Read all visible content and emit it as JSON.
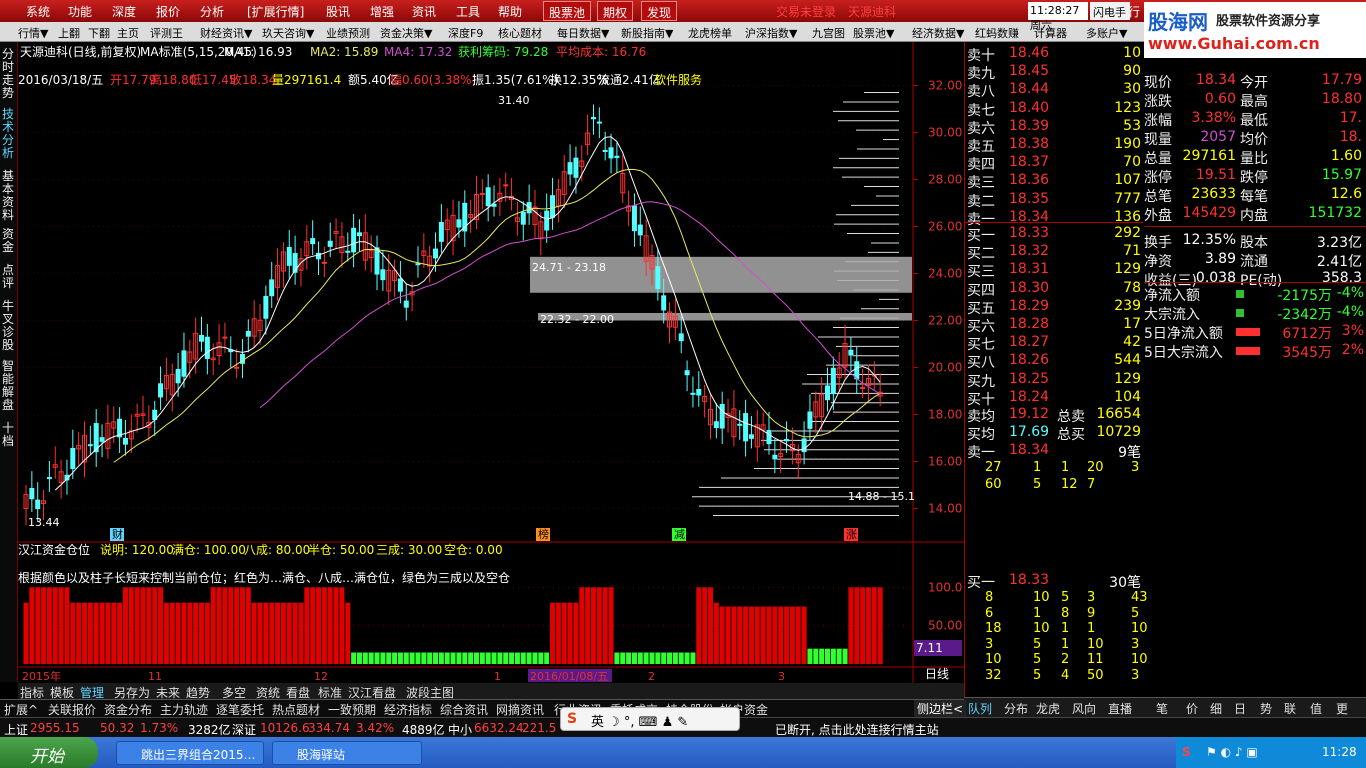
{
  "menubar": {
    "items": [
      "系统",
      "功能",
      "深度",
      "报价",
      "分析",
      "[扩展行情]",
      "股讯",
      "增强",
      "资讯",
      "工具",
      "帮助"
    ],
    "highlights": [
      "股票池",
      "期权",
      "发现"
    ],
    "login_warning": "交易未登录",
    "stock_name_top": "天源迪科",
    "clock": "11:28:27 周六",
    "flash_button": "闪电手",
    "trade_button": "行"
  },
  "brand": {
    "logo": "股海网",
    "slogan": "股票软件资源分享",
    "url": "www.Guhai.com.cn"
  },
  "toolbar": {
    "items": [
      "行情▼",
      "上翻",
      "下翻",
      "主页",
      "评测王",
      "财经资讯▼",
      "玖天咨询▼",
      "业绩预测",
      "资金决策▼",
      "深度F9",
      "核心题材",
      "每日数据▼",
      "新股指南▼",
      "龙虎榜单",
      "沪深指数▼",
      "九宫图",
      "股票池▼",
      "经济数据▼",
      "红蚂数赚",
      "计算器",
      "多账户▼"
    ]
  },
  "left_tabs": [
    {
      "label": "分时走势",
      "active": false
    },
    {
      "label": "技术分析",
      "active": true
    },
    {
      "label": "基本资料",
      "active": false
    },
    {
      "label": "资金",
      "active": false
    },
    {
      "label": "点评",
      "active": false
    },
    {
      "label": "牛叉诊股",
      "active": false
    },
    {
      "label": "智能解盘",
      "active": false
    },
    {
      "label": "十档",
      "active": false
    }
  ],
  "chart_header": {
    "title": "天源迪科(日线,前复权)",
    "ma_label": "MA标准(5,15,20,45)",
    "ma1": "MA1: 16.93",
    "ma2": "MA2: 15.89",
    "ma4": "MA4: 17.32",
    "profit_chips": "获利筹码: 79.28",
    "avg_cost": "平均成本: 16.76"
  },
  "ohlc_line": {
    "date": "2016/03/18/五",
    "open": "开17.79",
    "high": "高18.80",
    "low": "低17.45",
    "close": "收18.34",
    "volume": "量297161.4",
    "amount": "额5.40亿",
    "change": "幅0.60(3.38%)",
    "amplitude": "振1.35(7.61%)",
    "turnover": "换12.35%",
    "float": "流通2.41亿",
    "sector": "软件服务"
  },
  "chart_data": {
    "type": "candlestick",
    "x_range": [
      "2015年",
      "2016/01/08/五"
    ],
    "ylim": [
      13,
      33
    ],
    "y_ticks": [
      "32.00",
      "30.00",
      "28.00",
      "26.00",
      "24.00",
      "22.00",
      "20.00",
      "18.00",
      "16.00",
      "14.00"
    ],
    "price_labels": {
      "high": "31.40",
      "low": "13.44",
      "gap1": "24.71 - 23.18",
      "gap2": "22.32 - 22.00",
      "recent": "14.88 - 15.1"
    },
    "markers": [
      "财",
      "榜",
      "减",
      "涨"
    ],
    "sub_indicator": {
      "title": "汉江资金仓位",
      "description": "说明: 120.00",
      "full": "满仓: 100.00",
      "eighty": "八成: 80.00",
      "half": "半仓: 50.00",
      "thirty": "三成: 30.00",
      "empty": "空仓: 0.00",
      "note": "根据颜色以及柱子长短来控制当前仓位；红色为…满仓、八成…满仓位，绿色为三成以及空仓",
      "y_ticks": [
        "100.0",
        "50.00"
      ],
      "value_box": "7.11"
    },
    "x_axis": [
      "2015年",
      "11",
      "12",
      "1",
      "2016/01/08/五",
      "2",
      "3"
    ],
    "period": "日线"
  },
  "bottom_tabs": [
    "指标",
    "模板",
    "管理",
    "另存为",
    "未来",
    "趋势",
    "多空",
    "资统",
    "看盘",
    "标准",
    "汉江看盘",
    "波段主图"
  ],
  "ext_tabs": [
    "扩展^",
    "关联报价",
    "资金分布",
    "主力轨迹",
    "逐笔委托",
    "热点题材",
    "一致预期",
    "经济指标",
    "综合资讯",
    "网摘资讯",
    "行业资讯",
    "委托成交",
    "持仓股份",
    "帐户资金"
  ],
  "orderbook": {
    "sells": [
      {
        "l": "卖十",
        "p": "18.46",
        "v": "10"
      },
      {
        "l": "卖九",
        "p": "18.45",
        "v": "90"
      },
      {
        "l": "卖八",
        "p": "18.44",
        "v": "30"
      },
      {
        "l": "卖七",
        "p": "18.40",
        "v": "123"
      },
      {
        "l": "卖六",
        "p": "18.39",
        "v": "53"
      },
      {
        "l": "卖五",
        "p": "18.38",
        "v": "190"
      },
      {
        "l": "卖四",
        "p": "18.37",
        "v": "70"
      },
      {
        "l": "卖三",
        "p": "18.36",
        "v": "107"
      },
      {
        "l": "卖二",
        "p": "18.35",
        "v": "777"
      },
      {
        "l": "卖一",
        "p": "18.34",
        "v": "136"
      }
    ],
    "buys": [
      {
        "l": "买一",
        "p": "18.33",
        "v": "292"
      },
      {
        "l": "买二",
        "p": "18.32",
        "v": "71"
      },
      {
        "l": "买三",
        "p": "18.31",
        "v": "129"
      },
      {
        "l": "买四",
        "p": "18.30",
        "v": "78"
      },
      {
        "l": "买五",
        "p": "18.29",
        "v": "239"
      },
      {
        "l": "买六",
        "p": "18.28",
        "v": "17"
      },
      {
        "l": "买七",
        "p": "18.27",
        "v": "42"
      },
      {
        "l": "买八",
        "p": "18.26",
        "v": "544"
      },
      {
        "l": "买九",
        "p": "18.25",
        "v": "129"
      },
      {
        "l": "买十",
        "p": "18.24",
        "v": "104"
      }
    ],
    "avg_sell": "19.12",
    "total_sell": "16654",
    "avg_buy": "17.69",
    "total_buy": "10729",
    "sell1_price": "18.34",
    "sell1_count": "9笔",
    "sell1_queue": [
      "27",
      "1",
      "1",
      "20",
      "3",
      "60",
      "5",
      "12",
      "7"
    ],
    "buy1_price": "18.33",
    "buy1_count": "30笔",
    "buy1_queue": [
      "8",
      "10",
      "5",
      "3",
      "43",
      "6",
      "1",
      "8",
      "9",
      "5",
      "18",
      "10",
      "1",
      "1",
      "10",
      "3",
      "5",
      "1",
      "10",
      "3",
      "10",
      "5",
      "2",
      "11",
      "10",
      "32",
      "5",
      "4",
      "50",
      "3"
    ]
  },
  "quote": {
    "rows": [
      {
        "a": "现价",
        "av": "18.34",
        "b": "今开",
        "bv": "17.79"
      },
      {
        "a": "涨跌",
        "av": "0.60",
        "b": "最高",
        "bv": "18.80"
      },
      {
        "a": "涨幅",
        "av": "3.38%",
        "b": "最低",
        "bv": "17."
      },
      {
        "a": "现量",
        "av": "2057",
        "b": "均价",
        "bv": "18."
      },
      {
        "a": "总量",
        "av": "297161",
        "b": "量比",
        "bv": "1.60"
      },
      {
        "a": "涨停",
        "av": "19.51",
        "b": "跌停",
        "bv": "15.97"
      },
      {
        "a": "总笔",
        "av": "23633",
        "b": "每笔",
        "bv": "12.6"
      },
      {
        "a": "外盘",
        "av": "145429",
        "b": "内盘",
        "bv": "151732"
      },
      {
        "a": "换手",
        "av": "12.35%",
        "b": "股本",
        "bv": "3.23亿"
      },
      {
        "a": "净资",
        "av": "3.89",
        "b": "流通",
        "bv": "2.41亿"
      },
      {
        "a": "收益(三)",
        "av": "0.038",
        "b": "PE(动)",
        "bv": "358.3"
      }
    ],
    "flows": [
      {
        "l": "净流入额",
        "v": "-2175万",
        "p": "-4%"
      },
      {
        "l": "大宗流入",
        "v": "-2342万",
        "p": "-4%"
      },
      {
        "l": "5日净流入额",
        "v": "6712万",
        "p": "3%"
      },
      {
        "l": "5日大宗流入",
        "v": "3545万",
        "p": "2%"
      }
    ]
  },
  "right_tabs": [
    "队列",
    "分布",
    "龙虎",
    "风向",
    "直播",
    "笔",
    "价",
    "细",
    "日",
    "势",
    "联",
    "值",
    "更"
  ],
  "status": {
    "sh_label": "上证",
    "sh_val": "2955.15",
    "sh_chg": "50.32",
    "sh_pct": "1.73%",
    "sh_amt": "3282亿",
    "sz_label": "深证",
    "sz_val": "10126.6",
    "sz_chg": "334.74",
    "sz_pct": "3.42%",
    "sz_amt": "4889亿",
    "zx_label": "中小",
    "zx_val": "6632.24",
    "zx_chg": "221.5",
    "notice": "已断开, 点击此处连接行情主站",
    "sidebar": "侧边栏<"
  },
  "taskbar": {
    "start": "开始",
    "tasks": [
      "跳出三界组合2015…",
      "股海驿站"
    ],
    "time": "11:28"
  },
  "colors": {
    "up": "#ff3030",
    "down": "#54ffff",
    "ma1": "#ffffff",
    "ma2": "#e8e860",
    "ma4": "#d050d0",
    "accent": "#c8201e"
  }
}
